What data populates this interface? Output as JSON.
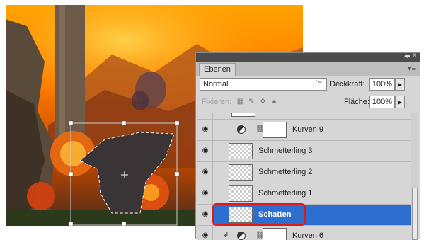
{
  "panel": {
    "tab_label": "Ebenen",
    "blend_mode": "Normal",
    "opacity_label": "Deckkraft:",
    "opacity_value": "100%",
    "lock_label": "Fixieren:",
    "fill_label": "Fläche:",
    "fill_value": "100%",
    "layers": [
      {
        "name": "Kurven 9",
        "type": "adjustment",
        "visible": true
      },
      {
        "name": "Schmetterling 3",
        "type": "pixel",
        "visible": true
      },
      {
        "name": "Schmetterling 2",
        "type": "pixel",
        "visible": true
      },
      {
        "name": "Schmetterling 1",
        "type": "pixel",
        "visible": true
      },
      {
        "name": "Schatten",
        "type": "pixel",
        "visible": true,
        "selected": true
      },
      {
        "name": "Kurven 6",
        "type": "adjustment",
        "visible": true
      }
    ]
  },
  "colors": {
    "selected_layer": "#2d6fd1",
    "highlight_border": "#e01818",
    "panel_bg": "#d6d6d6"
  }
}
